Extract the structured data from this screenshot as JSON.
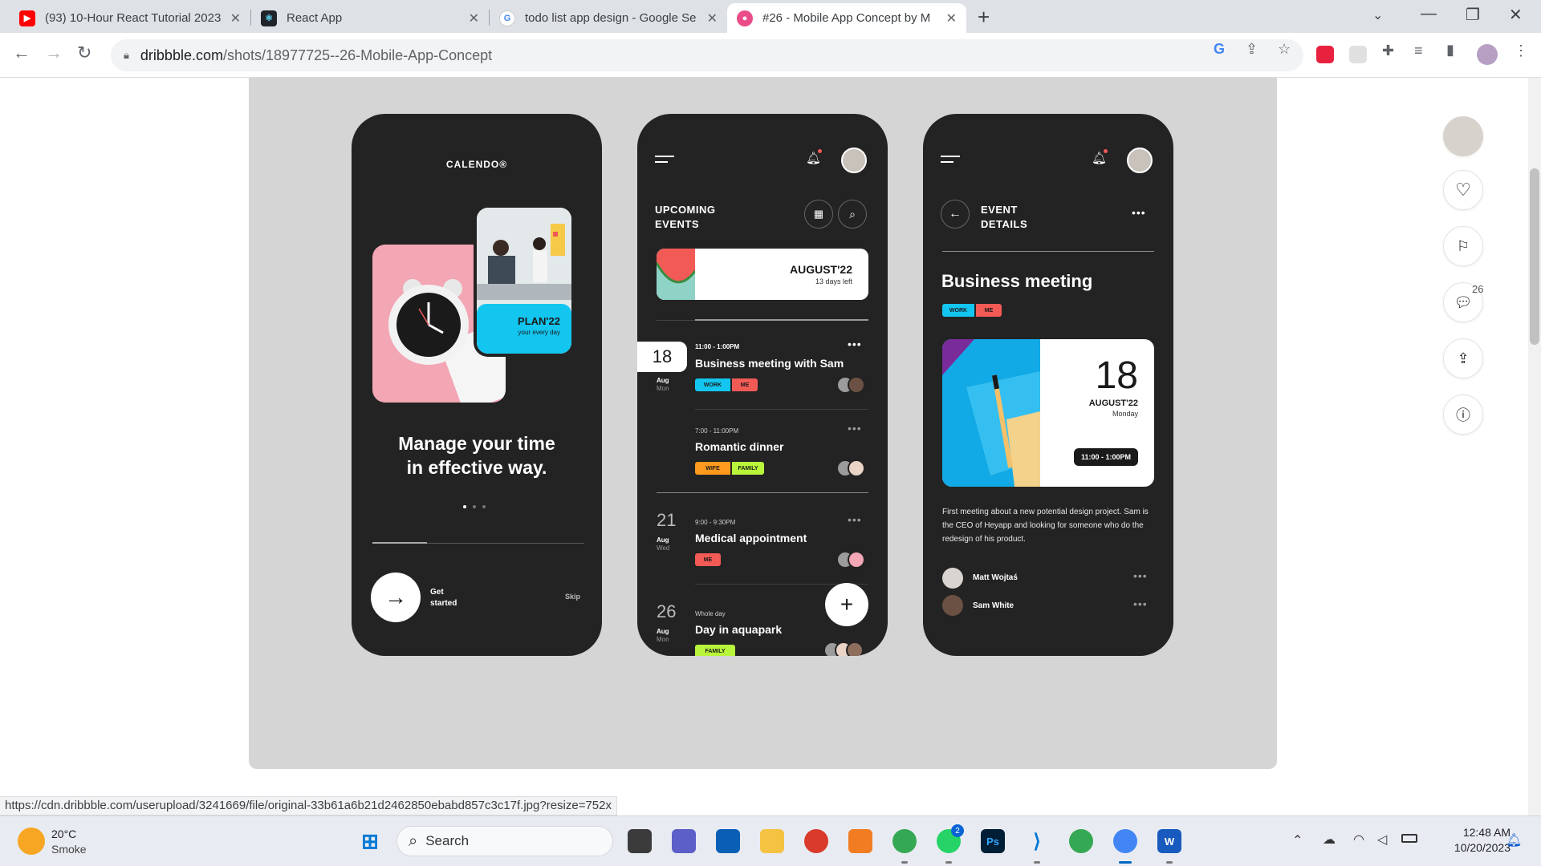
{
  "browser": {
    "tabs": [
      {
        "title": "(93) 10-Hour React Tutorial 2023",
        "icon": "youtube-icon"
      },
      {
        "title": "React App",
        "icon": "react-icon"
      },
      {
        "title": "todo list app design - Google Se",
        "icon": "google-icon"
      },
      {
        "title": "#26 - Mobile App Concept by M",
        "icon": "dribbble-icon",
        "active": true
      }
    ],
    "url_host": "dribbble.com",
    "url_path": "/shots/18977725--26-Mobile-App-Concept",
    "status_url": "https://cdn.dribbble.com/userupload/3241669/file/original-33b61a6b21d2462850ebabd857c3c17f.jpg?resize=752x"
  },
  "onboarding": {
    "brand": "CALENDO®",
    "plan_title": "PLAN'22",
    "plan_subtitle": "your every day",
    "headline_1": "Manage your time",
    "headline_2": "in effective way.",
    "cta_1": "Get",
    "cta_2": "started",
    "skip": "Skip"
  },
  "upcoming": {
    "title_1": "UPCOMING",
    "title_2": "EVENTS",
    "month_card_title": "AUGUST'22",
    "month_card_sub": "13 days left",
    "events": [
      {
        "day": "18",
        "month": "Aug",
        "weekday": "Mon",
        "time": "11:00 - 1:00PM",
        "title": "Business meeting with Sam",
        "tags": [
          "WORK",
          "ME"
        ]
      },
      {
        "day": "",
        "month": "",
        "weekday": "",
        "time": "7:00 - 11:00PM",
        "title": "Romantic dinner",
        "tags": [
          "WIFE",
          "FAMILY"
        ]
      },
      {
        "day": "21",
        "month": "Aug",
        "weekday": "Wed",
        "time": "9:00 - 9:30PM",
        "title": "Medical appointment",
        "tags": [
          "ME"
        ]
      },
      {
        "day": "26",
        "month": "Aug",
        "weekday": "Mon",
        "time": "Whole day",
        "title": "Day in aquapark",
        "tags": [
          "FAMILY"
        ]
      }
    ],
    "fab": "+"
  },
  "details": {
    "title_1": "EVENT",
    "title_2": "DETAILS",
    "event_title": "Business meeting",
    "tags": [
      "WORK",
      "ME"
    ],
    "date_day": "18",
    "date_month": "AUGUST'22",
    "date_weekday": "Monday",
    "time": "11:00 - 1:00PM",
    "description": "First meeting about a new potential design project. Sam is the CEO of Heyapp and looking for someone who do the redesign of his product.",
    "attendees": [
      "Matt Wojtaś",
      "Sam White"
    ]
  },
  "rail": {
    "comments_count": "26"
  },
  "taskbar": {
    "weather_temp": "20°C",
    "weather_desc": "Smoke",
    "search": "Search",
    "time": "12:48 AM",
    "date": "10/20/2023",
    "whatsapp_badge": "2"
  },
  "colors": {
    "phone_bg": "#232323",
    "cyan": "#13c6f0",
    "red": "#f25a56",
    "orange": "#ff9a1f",
    "lime": "#b9f53b",
    "pink": "#f3a6b4"
  }
}
